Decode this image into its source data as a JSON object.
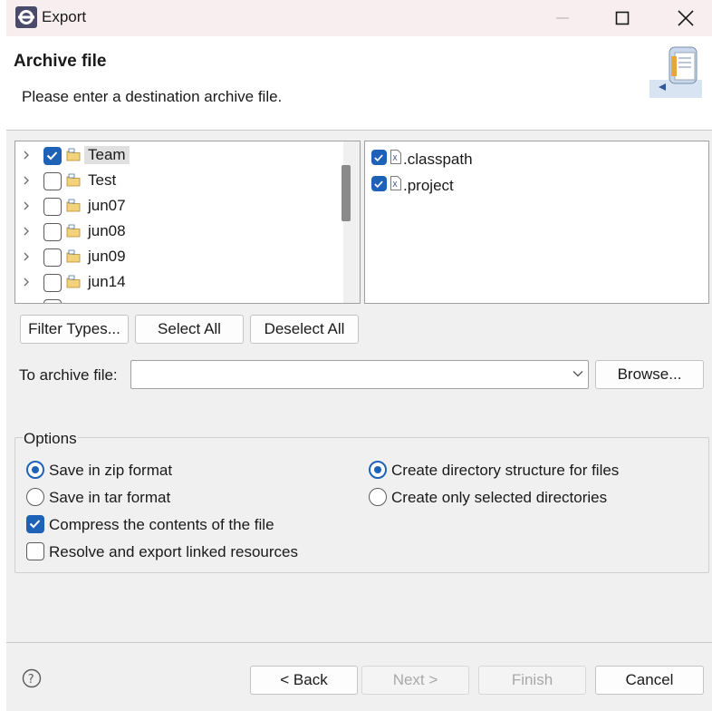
{
  "window": {
    "title": "Export",
    "icon": "eclipse-icon",
    "controls": [
      "minimize-icon",
      "maximize-icon",
      "close-icon"
    ]
  },
  "header": {
    "title": "Archive file",
    "message": "Please enter a destination archive file.",
    "icon": "archive-wizard-icon"
  },
  "tree": {
    "items": [
      {
        "label": "Team",
        "checked": true,
        "selected": true
      },
      {
        "label": "Test",
        "checked": false
      },
      {
        "label": "jun07",
        "checked": false
      },
      {
        "label": "jun08",
        "checked": false
      },
      {
        "label": "jun09",
        "checked": false
      },
      {
        "label": "jun14",
        "checked": false
      }
    ]
  },
  "files": {
    "items": [
      {
        "label": ".classpath",
        "checked": true
      },
      {
        "label": ".project",
        "checked": true
      }
    ]
  },
  "selection_buttons": {
    "filter_types": "Filter Types...",
    "select_all": "Select All",
    "deselect_all": "Deselect All"
  },
  "archive": {
    "label": "To archive file:",
    "value": "",
    "browse": "Browse..."
  },
  "options": {
    "title": "Options",
    "zip": {
      "label": "Save in zip format",
      "selected": true
    },
    "tar": {
      "label": "Save in tar format",
      "selected": false
    },
    "compress": {
      "label": "Compress the contents of the file",
      "checked": true
    },
    "resolve": {
      "label": "Resolve and export linked resources",
      "checked": false
    },
    "create_structure": {
      "label": "Create directory structure for files",
      "selected": true
    },
    "create_selected": {
      "label": "Create only selected directories",
      "selected": false
    }
  },
  "footer": {
    "back": "< Back",
    "next": "Next >",
    "finish": "Finish",
    "cancel": "Cancel",
    "help_icon": "help-icon"
  },
  "colors": {
    "accent": "#1e62b8",
    "titlebar": "#f8eeef",
    "dialog_bg": "#f0f0f0"
  }
}
